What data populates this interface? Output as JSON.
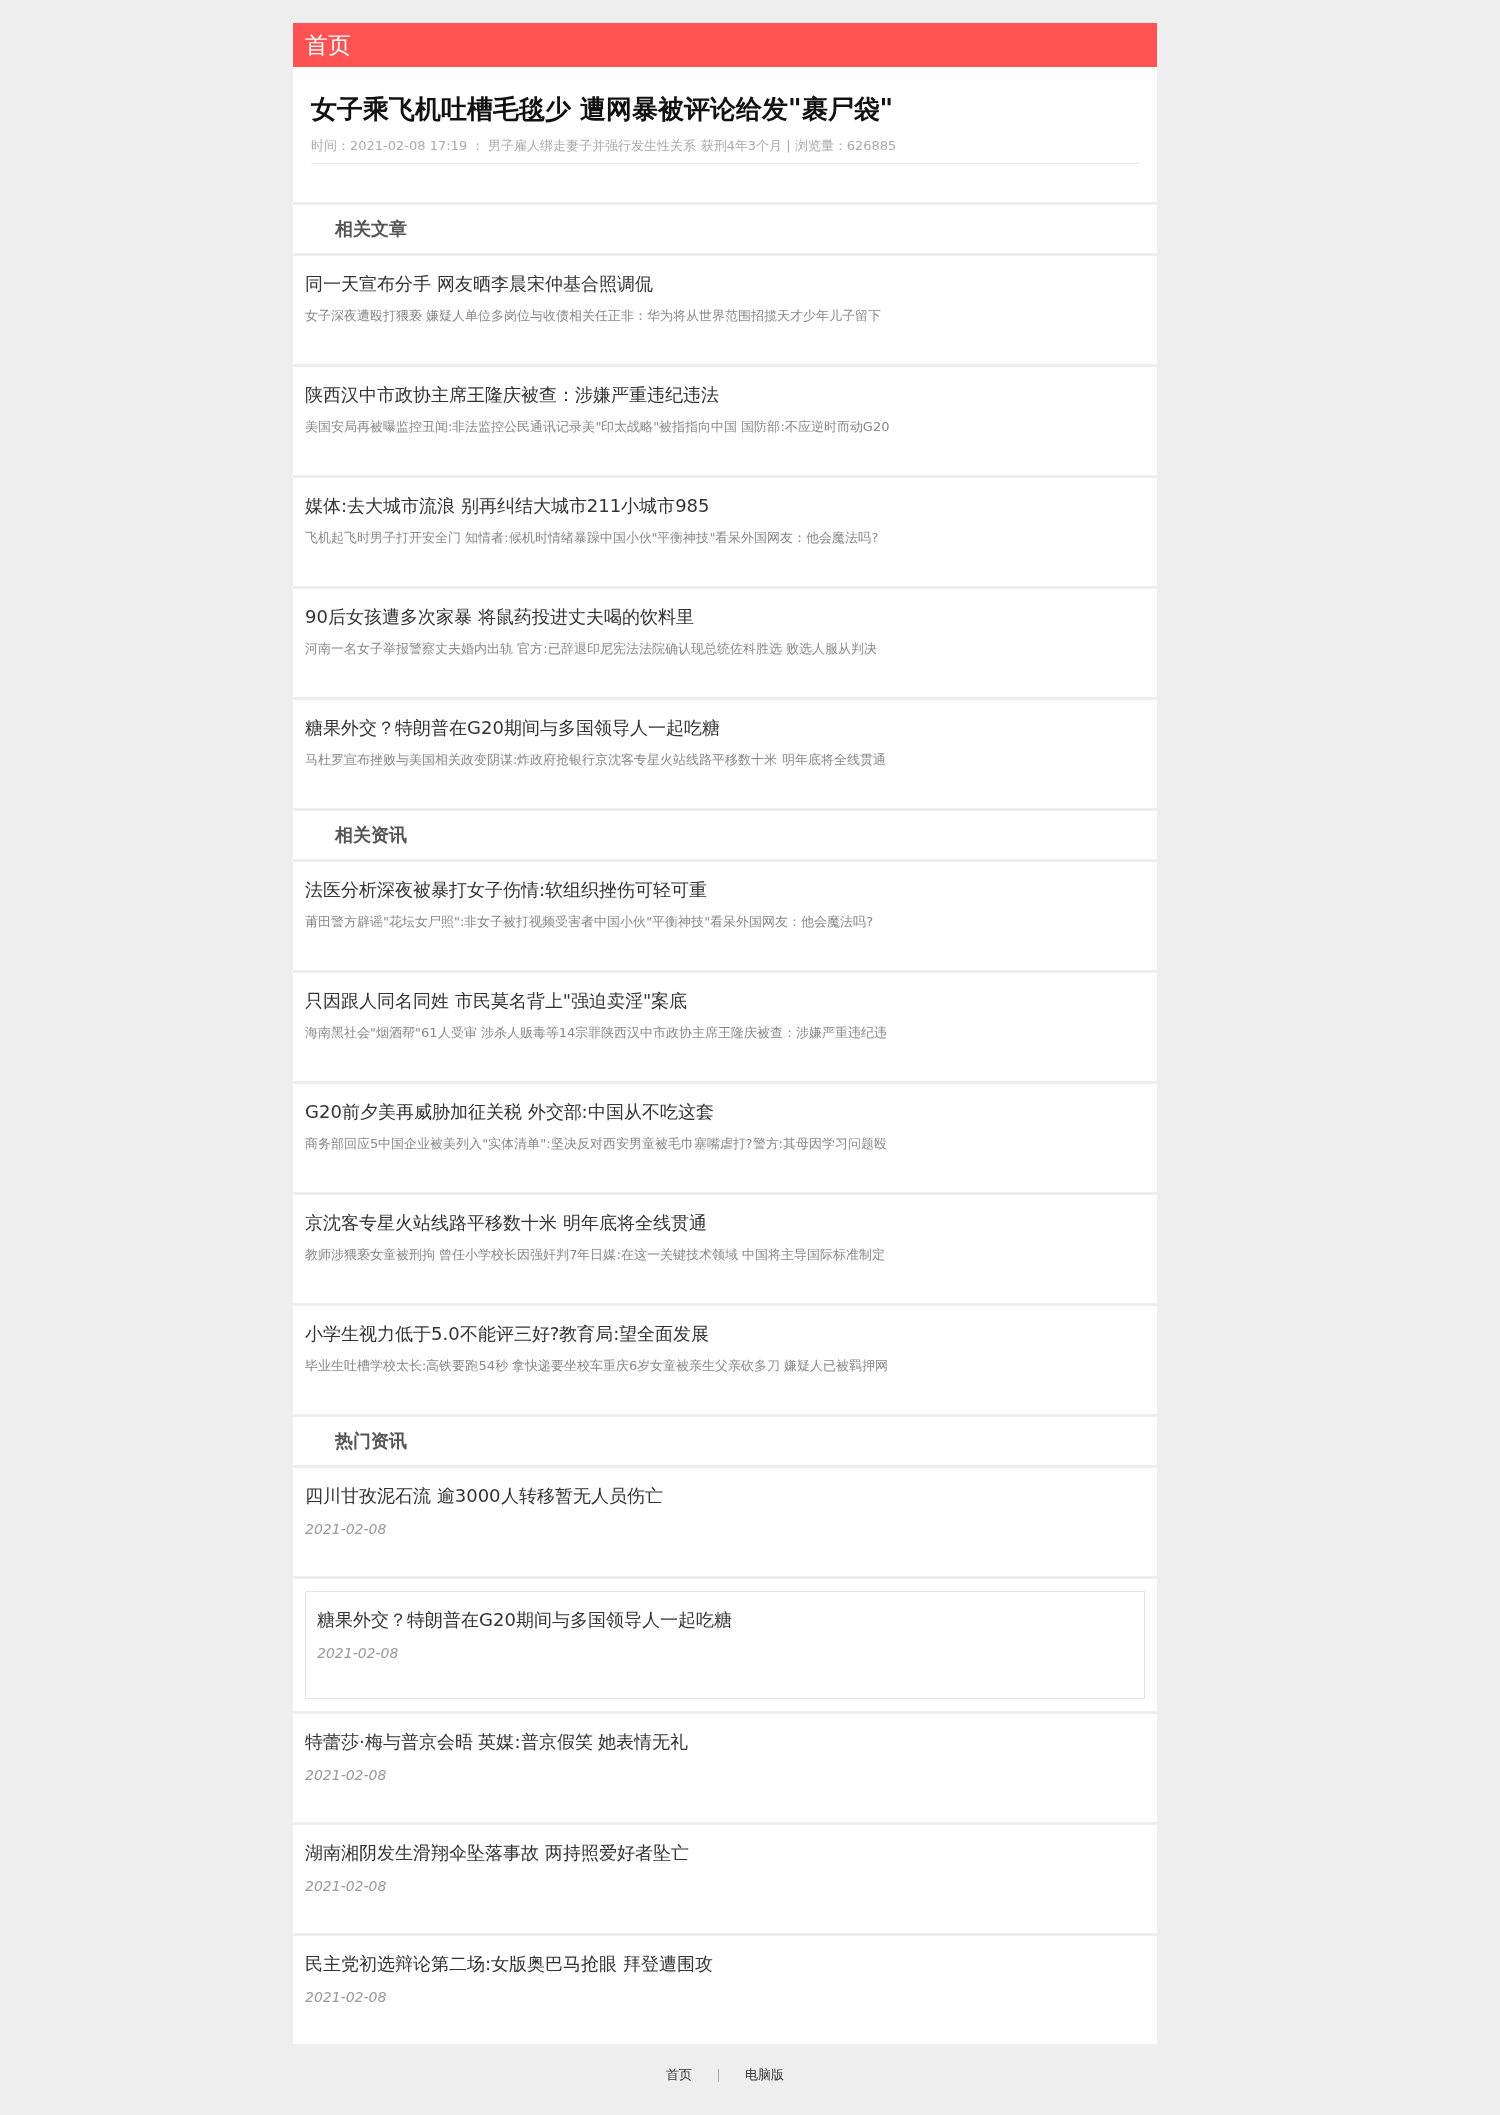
{
  "header": {
    "title": "首页"
  },
  "article": {
    "title": "女子乘飞机吐槽毛毯少 遭网暴被评论给发\"裹尸袋\"",
    "meta": "时间：2021-02-08 17:19 ： 男子雇人绑走妻子并强行发生性关系 获刑4年3个月 | 浏览量：626885"
  },
  "sections": [
    {
      "heading": "相关文章",
      "kind": "summary",
      "items": [
        {
          "title": "同一天宣布分手 网友晒李晨宋仲基合照调侃",
          "summary": "女子深夜遭殴打猥亵 嫌疑人单位多岗位与收债相关任正非：华为将从世界范围招揽天才少年儿子留下"
        },
        {
          "title": "陕西汉中市政协主席王隆庆被查：涉嫌严重违纪违法",
          "summary": "美国安局再被曝监控丑闻:非法监控公民通讯记录美\"印太战略\"被指指向中国 国防部:不应逆时而动G20"
        },
        {
          "title": "媒体:去大城市流浪 别再纠结大城市211小城市985",
          "summary": "飞机起飞时男子打开安全门 知情者:候机时情绪暴躁中国小伙\"平衡神技\"看呆外国网友：他会魔法吗?"
        },
        {
          "title": "90后女孩遭多次家暴 将鼠药投进丈夫喝的饮料里",
          "summary": "河南一名女子举报警察丈夫婚内出轨 官方:已辞退印尼宪法法院确认现总统佐科胜选 败选人服从判决"
        },
        {
          "title": "糖果外交？特朗普在G20期间与多国领导人一起吃糖",
          "summary": "马杜罗宣布挫败与美国相关政变阴谋:炸政府抢银行京沈客专星火站线路平移数十米 明年底将全线贯通"
        }
      ]
    },
    {
      "heading": "相关资讯",
      "kind": "summary",
      "items": [
        {
          "title": "法医分析深夜被暴打女子伤情:软组织挫伤可轻可重",
          "summary": "莆田警方辟谣\"花坛女尸照\":非女子被打视频受害者中国小伙\"平衡神技\"看呆外国网友：他会魔法吗?"
        },
        {
          "title": "只因跟人同名同姓 市民莫名背上\"强迫卖淫\"案底",
          "summary": "海南黑社会\"烟酒帮\"61人受审 涉杀人贩毒等14宗罪陕西汉中市政协主席王隆庆被查：涉嫌严重违纪违"
        },
        {
          "title": "G20前夕美再威胁加征关税 外交部:中国从不吃这套",
          "summary": "商务部回应5中国企业被美列入\"实体清单\":坚决反对西安男童被毛巾塞嘴虐打?警方:其母因学习问题殴"
        },
        {
          "title": "京沈客专星火站线路平移数十米 明年底将全线贯通",
          "summary": "教师涉猥亵女童被刑拘 曾任小学校长因强奸判7年日媒:在这一关键技术领域 中国将主导国际标准制定"
        },
        {
          "title": "小学生视力低于5.0不能评三好?教育局:望全面发展",
          "summary": "毕业生吐槽学校太长:高铁要跑54秒 拿快递要坐校车重庆6岁女童被亲生父亲砍多刀 嫌疑人已被羁押网"
        }
      ]
    },
    {
      "heading": "热门资讯",
      "kind": "dated",
      "items": [
        {
          "title": "四川甘孜泥石流 逾3000人转移暂无人员伤亡",
          "date": "2021-02-08",
          "selected": false
        },
        {
          "title": "糖果外交？特朗普在G20期间与多国领导人一起吃糖",
          "date": "2021-02-08",
          "selected": true
        },
        {
          "title": "特蕾莎·梅与普京会晤 英媒:普京假笑 她表情无礼",
          "date": "2021-02-08",
          "selected": false
        },
        {
          "title": "湖南湘阴发生滑翔伞坠落事故 两持照爱好者坠亡",
          "date": "2021-02-08",
          "selected": false
        },
        {
          "title": "民主党初选辩论第二场:女版奥巴马抢眼 拜登遭围攻",
          "date": "2021-02-08",
          "selected": false
        }
      ]
    }
  ],
  "footer": {
    "links": [
      "首页",
      "电脑版"
    ]
  }
}
